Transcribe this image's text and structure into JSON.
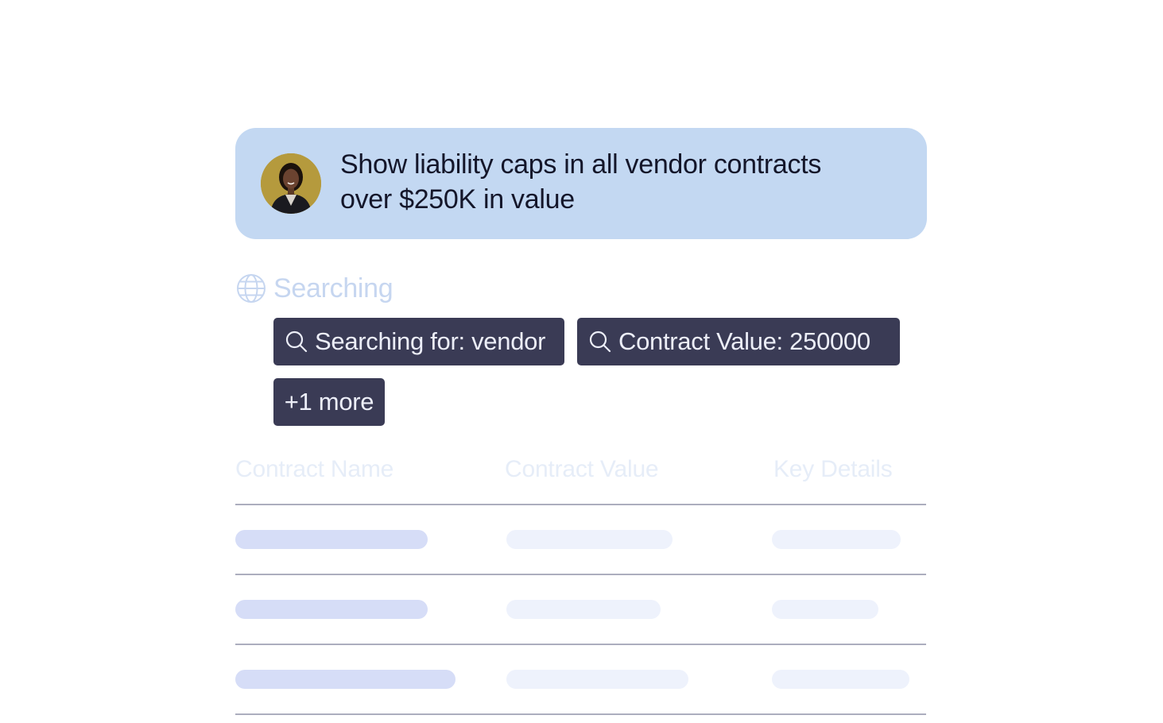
{
  "prompt": {
    "avatar_icon": "user-avatar-photo",
    "text_line1": "Show liability caps in all vendor contracts",
    "text_line2": "over $250K in value"
  },
  "status": {
    "icon": "globe-icon",
    "label": "Searching"
  },
  "search_chips": [
    {
      "icon": "search-icon",
      "label": "Searching for: vendor"
    },
    {
      "icon": "search-icon",
      "label": "Contract Value: 250000"
    },
    {
      "label": "+1 more"
    }
  ],
  "table": {
    "columns": [
      "Contract Name",
      "Contract Value",
      "Key Details"
    ],
    "row_count": 3,
    "rows_state": "loading-placeholder"
  },
  "colors": {
    "prompt_bg": "#c3d8f2",
    "chip_bg": "#3a3b55",
    "chip_text": "#eceef8",
    "status_text": "#c6d6f0",
    "header_text": "#e6edf8",
    "skeleton_name": "#d6ddf7",
    "skeleton_other": "#eef2fc"
  }
}
